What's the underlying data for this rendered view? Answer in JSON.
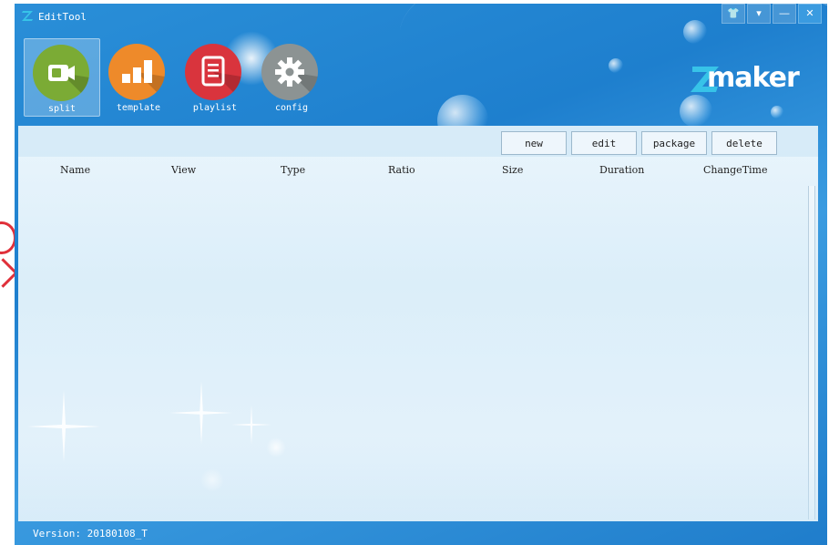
{
  "window": {
    "title": "EditTool"
  },
  "window_controls": [
    {
      "name": "skin-button",
      "glyph": "👕"
    },
    {
      "name": "menu-button",
      "glyph": "▾"
    },
    {
      "name": "minimize-button",
      "glyph": "—"
    },
    {
      "name": "close-button",
      "glyph": "✕"
    }
  ],
  "nav": {
    "items": [
      {
        "label": "split",
        "color": "#7bab35",
        "icon": "video-camera-icon"
      },
      {
        "label": "template",
        "color": "#ee8a2a",
        "icon": "bar-chart-icon"
      },
      {
        "label": "playlist",
        "color": "#d9343d",
        "icon": "document-list-icon"
      },
      {
        "label": "config",
        "color": "#8c9393",
        "icon": "gear-icon"
      }
    ],
    "active": "split"
  },
  "brand": {
    "text": "maker",
    "mark": "Z",
    "mark_color": "#37c3e8"
  },
  "toolbar": {
    "new_label": "new",
    "edit_label": "edit",
    "package_label": "package",
    "delete_label": "delete"
  },
  "table": {
    "columns": [
      "Name",
      "View",
      "Type",
      "Ratio",
      "Size",
      "Duration",
      "ChangeTime"
    ],
    "rows": []
  },
  "status": {
    "version": "Version: 20180108_T"
  }
}
